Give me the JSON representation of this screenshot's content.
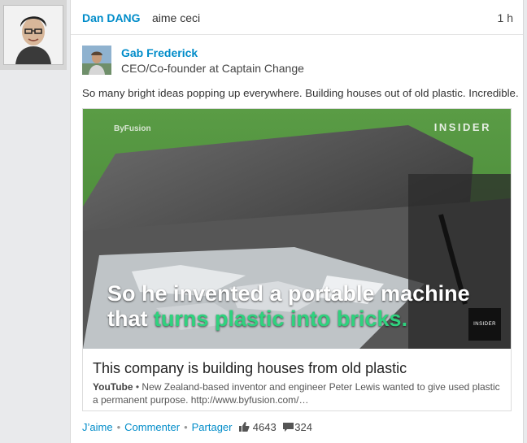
{
  "activity": {
    "actor": "Dan DANG",
    "action": "aime ceci",
    "time": "1 h"
  },
  "post": {
    "author": {
      "name": "Gab Frederick",
      "title": "CEO/Co-founder at Captain Change"
    },
    "text": "So many bright ideas popping up everywhere. Building houses out of old plastic. Incredible."
  },
  "share": {
    "watermark_left": "ByFusion",
    "watermark_right": "INSIDER",
    "caption_line1": "So he invented a portable machine",
    "caption_line2_prefix": "that ",
    "caption_line2_highlight": "turns plastic into bricks.",
    "logo_text": "INSIDER",
    "title": "This company is building houses from old plastic",
    "source": "YouTube",
    "description": " • New Zealand-based inventor and engineer Peter Lewis wanted to give used plastic a permanent purpose. http://www.byfusion.com/…"
  },
  "actions": {
    "like": "J’aime",
    "comment": "Commenter",
    "share": "Partager",
    "like_count": "4643",
    "comment_count": "324"
  },
  "colors": {
    "link": "#008cc9",
    "caption_highlight": "#2fd27e",
    "video_bg": "#4d8f3d"
  }
}
